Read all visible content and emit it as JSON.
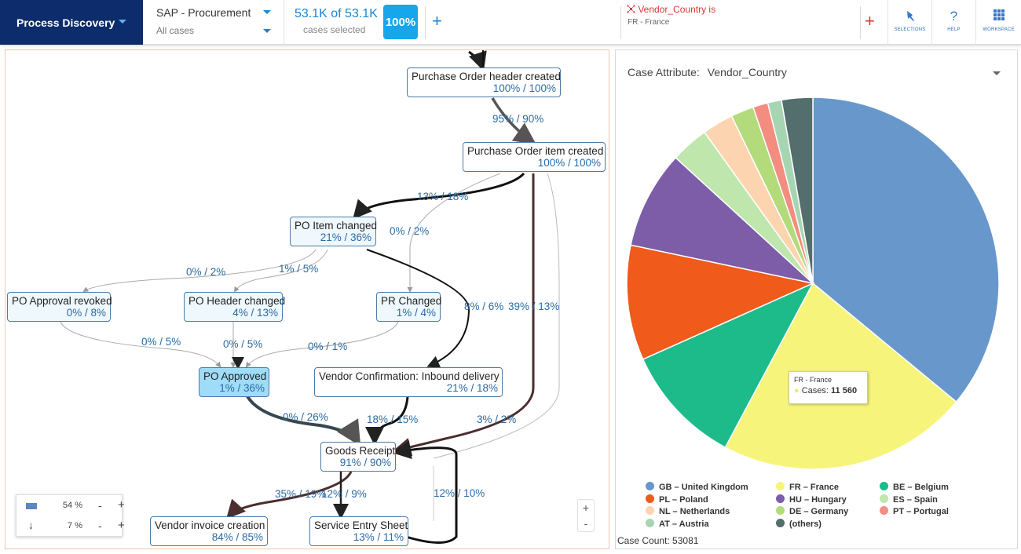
{
  "app": {
    "title": "Process Discovery"
  },
  "dataset": {
    "name": "SAP - Procurement",
    "scope": "All cases"
  },
  "selection": {
    "count_text": "53.1K of 53.1K",
    "caption": "cases selected",
    "percent": "100%"
  },
  "filter": {
    "title": "Vendor_Country is",
    "value": "FR - France"
  },
  "toolbar": {
    "selections_label": "SELECTIONS",
    "help_label": "HELP",
    "workspace_label": "WORKSPACE",
    "help_glyph": "?"
  },
  "graph": {
    "nodes": [
      {
        "name": "Purchase Order header created",
        "value": "100% / 100%"
      },
      {
        "name": "Purchase Order item created",
        "value": "100% / 100%"
      },
      {
        "name": "PO Item changed",
        "value": "21% / 36%"
      },
      {
        "name": "PO Approval revoked",
        "value": "0% / 8%"
      },
      {
        "name": "PO Header changed",
        "value": "4% / 13%"
      },
      {
        "name": "PR Changed",
        "value": "1% / 4%"
      },
      {
        "name": "PO Approved",
        "value": "1% / 36%"
      },
      {
        "name": "Vendor Confirmation: Inbound delivery",
        "value": "21% / 18%"
      },
      {
        "name": "Goods Receipt",
        "value": "91% / 90%"
      },
      {
        "name": "Vendor invoice creation",
        "value": "84% / 85%"
      },
      {
        "name": "Service Entry Sheet",
        "value": "13% / 11%"
      }
    ],
    "edge_labels": [
      "95% / 90%",
      "13% / 18%",
      "0% / 2%",
      "0% / 2%",
      "1% / 5%",
      "8% / 6%",
      "39% / 13%",
      "0% / 5%",
      "0% / 5%",
      "0% / 1%",
      "0% / 26%",
      "18% / 15%",
      "3% / 2%",
      "35% / 19%",
      "12% / 9%",
      "12% / 10%"
    ],
    "legend": {
      "activity_pct": "54 %",
      "path_pct": "7 %",
      "minus": "-",
      "plus": "+"
    },
    "zoom": {
      "in": "+",
      "out": "-"
    }
  },
  "pie_panel": {
    "attribute_label": "Case Attribute:",
    "attribute_value": "Vendor_Country",
    "tooltip": {
      "title": "FR - France",
      "label": "Cases:",
      "value": "11 560"
    },
    "case_count_label": "Case Count:",
    "case_count_value": "53081"
  },
  "chart_data": {
    "type": "pie",
    "title": "",
    "slices": [
      {
        "label": "GB – United Kingdom",
        "value": 36.0,
        "color": "#6897cb"
      },
      {
        "label": "FR – France",
        "value": 21.8,
        "color": "#f7f47c"
      },
      {
        "label": "BE – Belgium",
        "value": 10.5,
        "color": "#1dbb8a"
      },
      {
        "label": "PL – Poland",
        "value": 10.0,
        "color": "#f05a1b"
      },
      {
        "label": "HU – Hungary",
        "value": 8.5,
        "color": "#7d5ca8"
      },
      {
        "label": "ES – Spain",
        "value": 3.3,
        "color": "#bfe6ad"
      },
      {
        "label": "NL – Netherlands",
        "value": 2.7,
        "color": "#fcd4b0"
      },
      {
        "label": "DE – Germany",
        "value": 2.0,
        "color": "#b3db7c"
      },
      {
        "label": "PT – Portugal",
        "value": 1.3,
        "color": "#f28d80"
      },
      {
        "label": "AT – Austria",
        "value": 1.2,
        "color": "#a7d5b2"
      },
      {
        "label": "(others)",
        "value": 2.7,
        "color": "#546d6d"
      }
    ],
    "legend_position": "bottom"
  }
}
